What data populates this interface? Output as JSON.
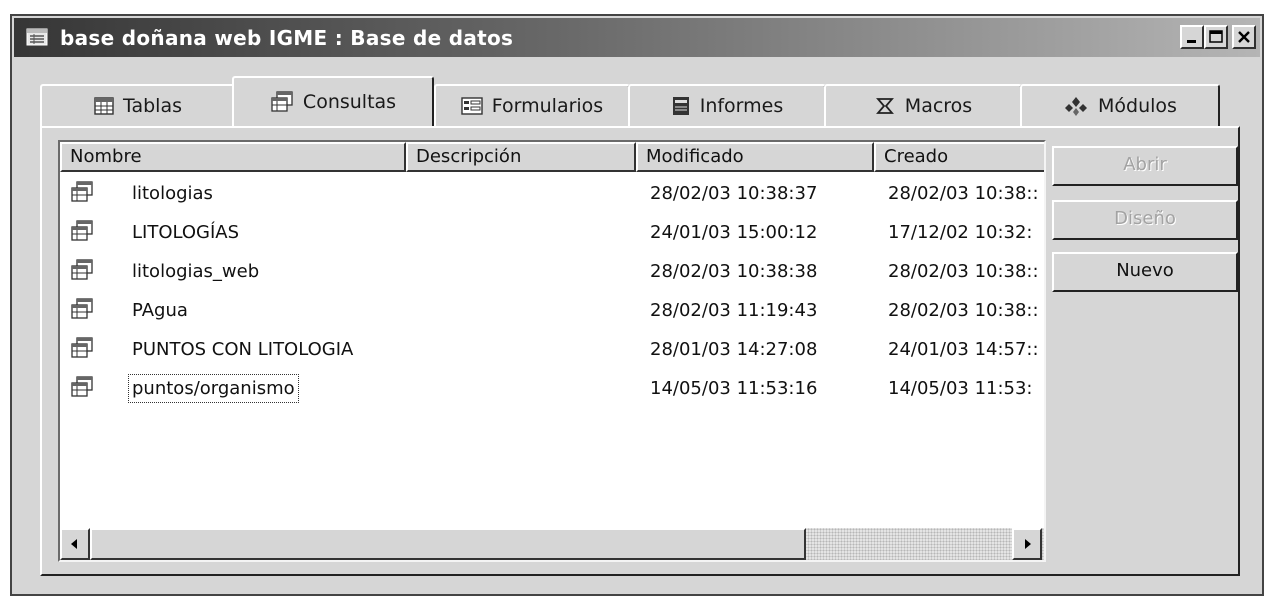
{
  "window": {
    "title": "base doñana web IGME : Base de datos",
    "icon": "database-window-icon"
  },
  "titlebar_buttons": [
    {
      "name": "minimize-button",
      "icon": "minimize-icon"
    },
    {
      "name": "maximize-button",
      "icon": "maximize-icon"
    },
    {
      "name": "close-button",
      "icon": "close-icon"
    }
  ],
  "tabs": [
    {
      "label": "Tablas",
      "icon": "table-icon",
      "active": false
    },
    {
      "label": "Consultas",
      "icon": "query-icon",
      "active": true
    },
    {
      "label": "Formularios",
      "icon": "form-icon",
      "active": false
    },
    {
      "label": "Informes",
      "icon": "report-icon",
      "active": false
    },
    {
      "label": "Macros",
      "icon": "macro-icon",
      "active": false
    },
    {
      "label": "Módulos",
      "icon": "module-icon",
      "active": false
    }
  ],
  "list": {
    "columns": [
      "Nombre",
      "Descripción",
      "Modificado",
      "Creado"
    ],
    "rows": [
      {
        "name": "litologias",
        "description": "",
        "modified": "28/02/03 10:38:37",
        "created": "28/02/03 10:38::"
      },
      {
        "name": "LITOLOGÍAS",
        "description": "",
        "modified": "24/01/03 15:00:12",
        "created": "17/12/02 10:32:"
      },
      {
        "name": "litologias_web",
        "description": "",
        "modified": "28/02/03 10:38:38",
        "created": "28/02/03 10:38::"
      },
      {
        "name": "PAgua",
        "description": "",
        "modified": "28/02/03 11:19:43",
        "created": "28/02/03 10:38::"
      },
      {
        "name": "PUNTOS CON LITOLOGIA",
        "description": "",
        "modified": "28/01/03 14:27:08",
        "created": "24/01/03 14:57::"
      },
      {
        "name": "puntos/organismo",
        "description": "",
        "modified": "14/05/03 11:53:16",
        "created": "14/05/03 11:53:",
        "focused": true
      }
    ],
    "row_icon": "query-icon"
  },
  "buttons": {
    "open": {
      "label": "Abrir",
      "enabled": false
    },
    "design": {
      "label": "Diseño",
      "enabled": false
    },
    "new": {
      "label": "Nuevo",
      "enabled": true
    }
  },
  "colors": {
    "face": "#d6d6d6",
    "title_start": "#363636",
    "title_end": "#b5b5b5"
  }
}
